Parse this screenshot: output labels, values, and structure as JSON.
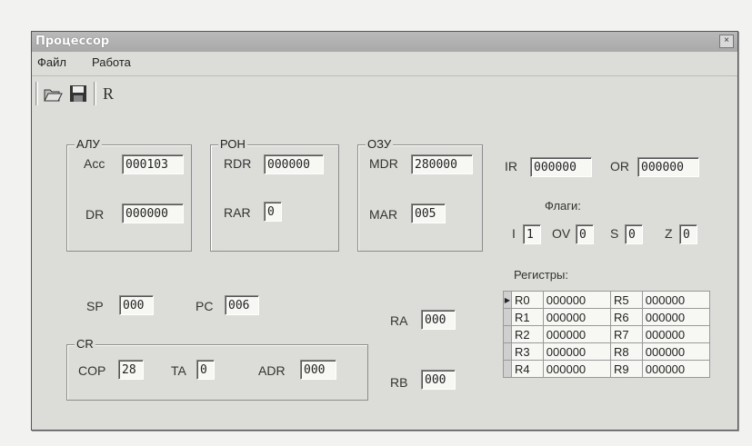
{
  "window": {
    "title": "Процессор",
    "close": "×"
  },
  "menu": [
    "Файл",
    "Работа"
  ],
  "toolbar": {
    "open_icon": "folder-open-icon",
    "save_icon": "floppy-disk-icon",
    "r_label": "R"
  },
  "alu": {
    "title": "АЛУ",
    "acc_label": "Acc",
    "acc": "000103",
    "dr_label": "DR",
    "dr": "000000"
  },
  "ron": {
    "title": "РОН",
    "rdr_label": "RDR",
    "rdr": "000000",
    "rar_label": "RAR",
    "rar": "0"
  },
  "ozu": {
    "title": "ОЗУ",
    "mdr_label": "MDR",
    "mdr": "280000",
    "mar_label": "MAR",
    "mar": "005"
  },
  "ir": {
    "label": "IR",
    "value": "000000"
  },
  "or": {
    "label": "OR",
    "value": "000000"
  },
  "flags": {
    "title": "Флаги:",
    "i_label": "I",
    "i": "1",
    "ov_label": "OV",
    "ov": "0",
    "s_label": "S",
    "s": "0",
    "z_label": "Z",
    "z": "0"
  },
  "sp": {
    "label": "SP",
    "value": "000"
  },
  "pc": {
    "label": "PC",
    "value": "006"
  },
  "ra": {
    "label": "RA",
    "value": "000"
  },
  "rb": {
    "label": "RB",
    "value": "000"
  },
  "cr": {
    "title": "CR",
    "cop_label": "COP",
    "cop": "28",
    "ta_label": "TA",
    "ta": "0",
    "adr_label": "ADR",
    "adr": "000"
  },
  "registers": {
    "title": "Регистры:",
    "rows": [
      {
        "l": "R0",
        "lv": "000000",
        "r": "R5",
        "rv": "000000",
        "current": true
      },
      {
        "l": "R1",
        "lv": "000000",
        "r": "R6",
        "rv": "000000"
      },
      {
        "l": "R2",
        "lv": "000000",
        "r": "R7",
        "rv": "000000"
      },
      {
        "l": "R3",
        "lv": "000000",
        "r": "R8",
        "rv": "000000"
      },
      {
        "l": "R4",
        "lv": "000000",
        "r": "R9",
        "rv": "000000"
      }
    ]
  }
}
